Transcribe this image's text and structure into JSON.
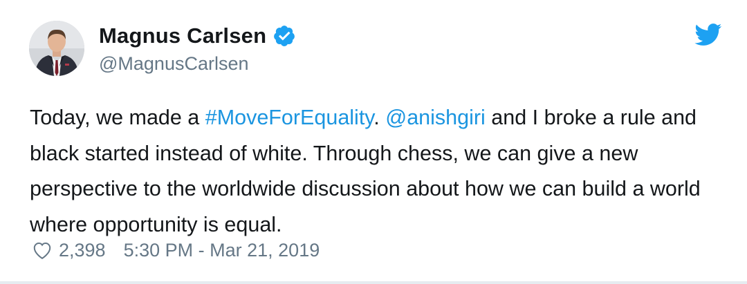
{
  "author": {
    "display_name": "Magnus Carlsen",
    "handle": "@MagnusCarlsen",
    "verified": true,
    "avatar_icon": "avatar-photo"
  },
  "tweet": {
    "segments": [
      {
        "text": "Today, we made a ",
        "type": "text"
      },
      {
        "text": "#MoveForEquality",
        "type": "hashtag"
      },
      {
        "text": ". ",
        "type": "text"
      },
      {
        "text": "@anishgiri",
        "type": "mention"
      },
      {
        "text": " and I broke a rule and black started instead of white. Through chess, we can give a new perspective to the worldwide discussion about how we can build a world where opportunity is equal.",
        "type": "text"
      }
    ]
  },
  "footer": {
    "like_count": "2,398",
    "timestamp": "5:30 PM - Mar 21, 2019"
  },
  "icons": {
    "verified": "verified-badge-icon",
    "brand": "twitter-bird-icon",
    "like": "heart-icon"
  },
  "colors": {
    "link": "#1b95e0",
    "verified": "#1da1f2",
    "brand": "#1da1f2",
    "text": "#14171a",
    "muted": "#657786"
  }
}
